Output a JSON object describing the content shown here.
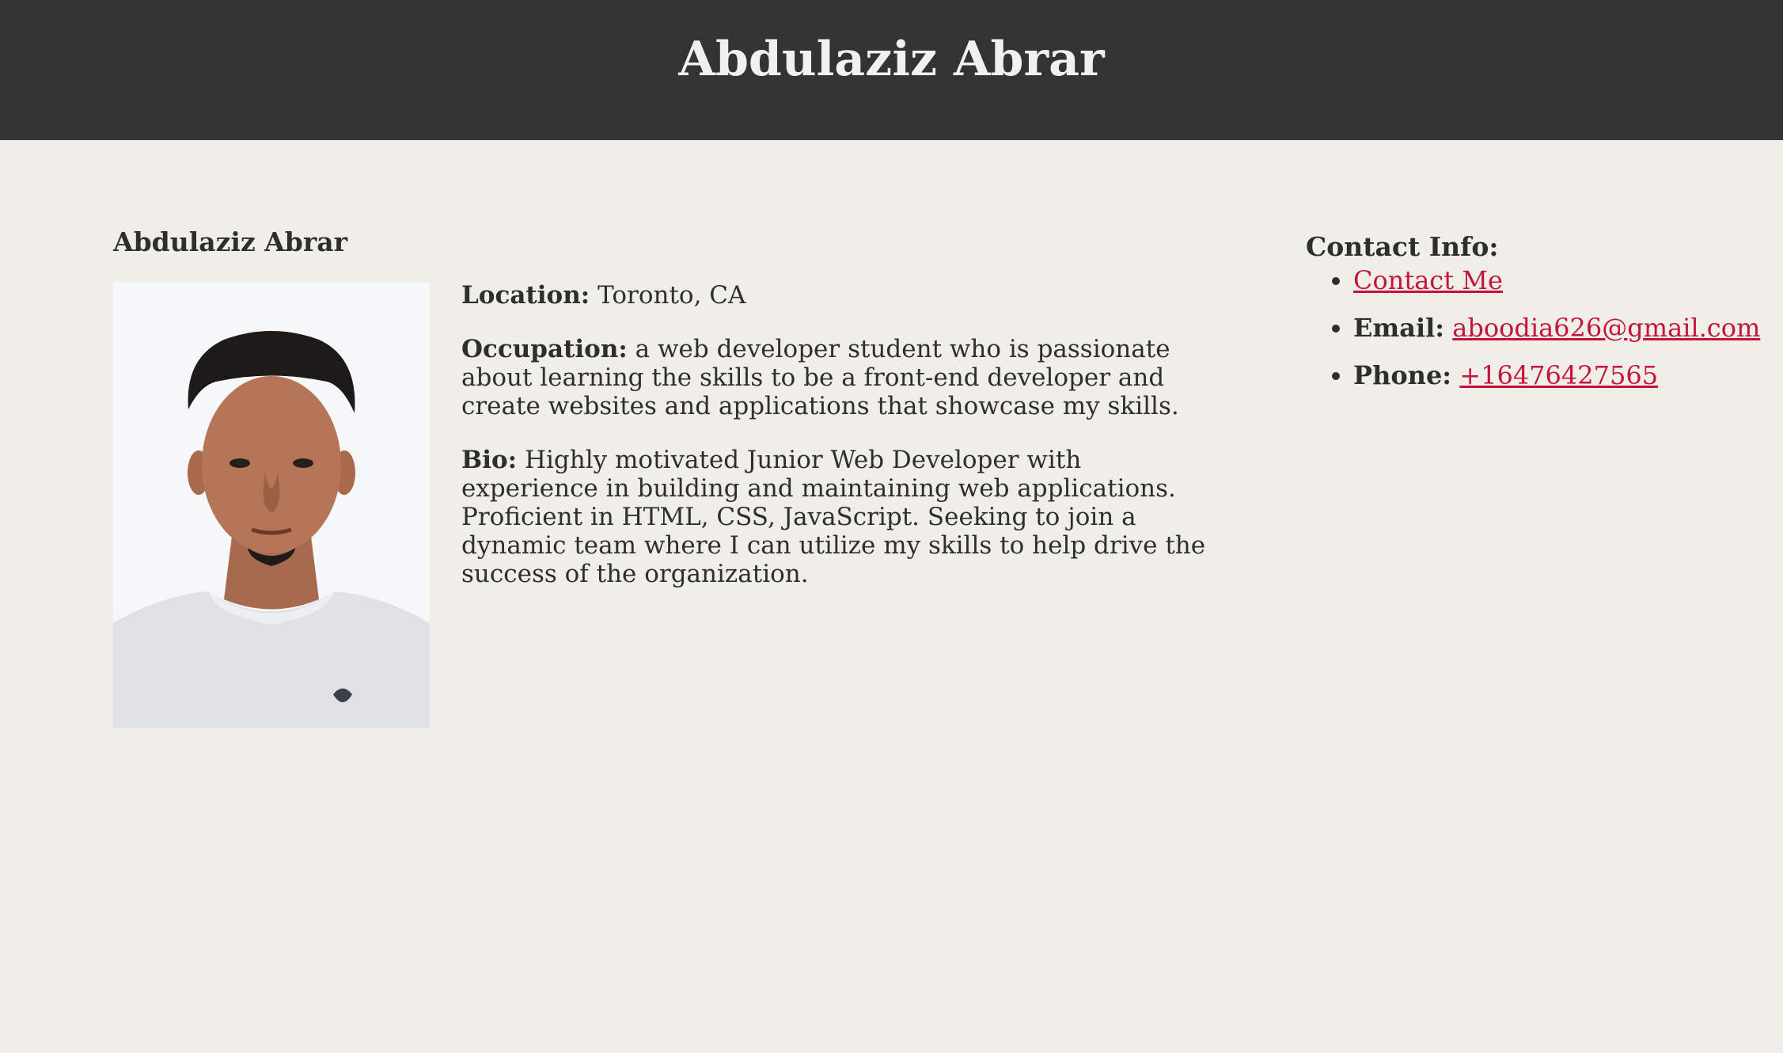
{
  "header": {
    "title": "Abdulaziz Abrar"
  },
  "profile": {
    "name": "Abdulaziz Abrar",
    "location_label": "Location:",
    "location_value": "Toronto, CA",
    "occupation_label": "Occupation:",
    "occupation_value": "a web developer student who is passionate about learning the skills to be a front-end developer and create websites and applications that showcase my skills.",
    "bio_label": "Bio:",
    "bio_value": "Highly motivated Junior Web Developer with experience in building and maintaining web applications. Proficient in HTML, CSS, JavaScript. Seeking to join a dynamic team where I can utilize my skills to help drive the success of the organization."
  },
  "contact": {
    "heading": "Contact Info:",
    "contact_link": "Contact Me",
    "email_label": "Email:",
    "email_value": "aboodia626@gmail.com",
    "phone_label": "Phone:",
    "phone_value": "+16476427565"
  },
  "colors": {
    "header_bg": "#333333",
    "page_bg": "#efeee9",
    "link": "#c4133c"
  }
}
